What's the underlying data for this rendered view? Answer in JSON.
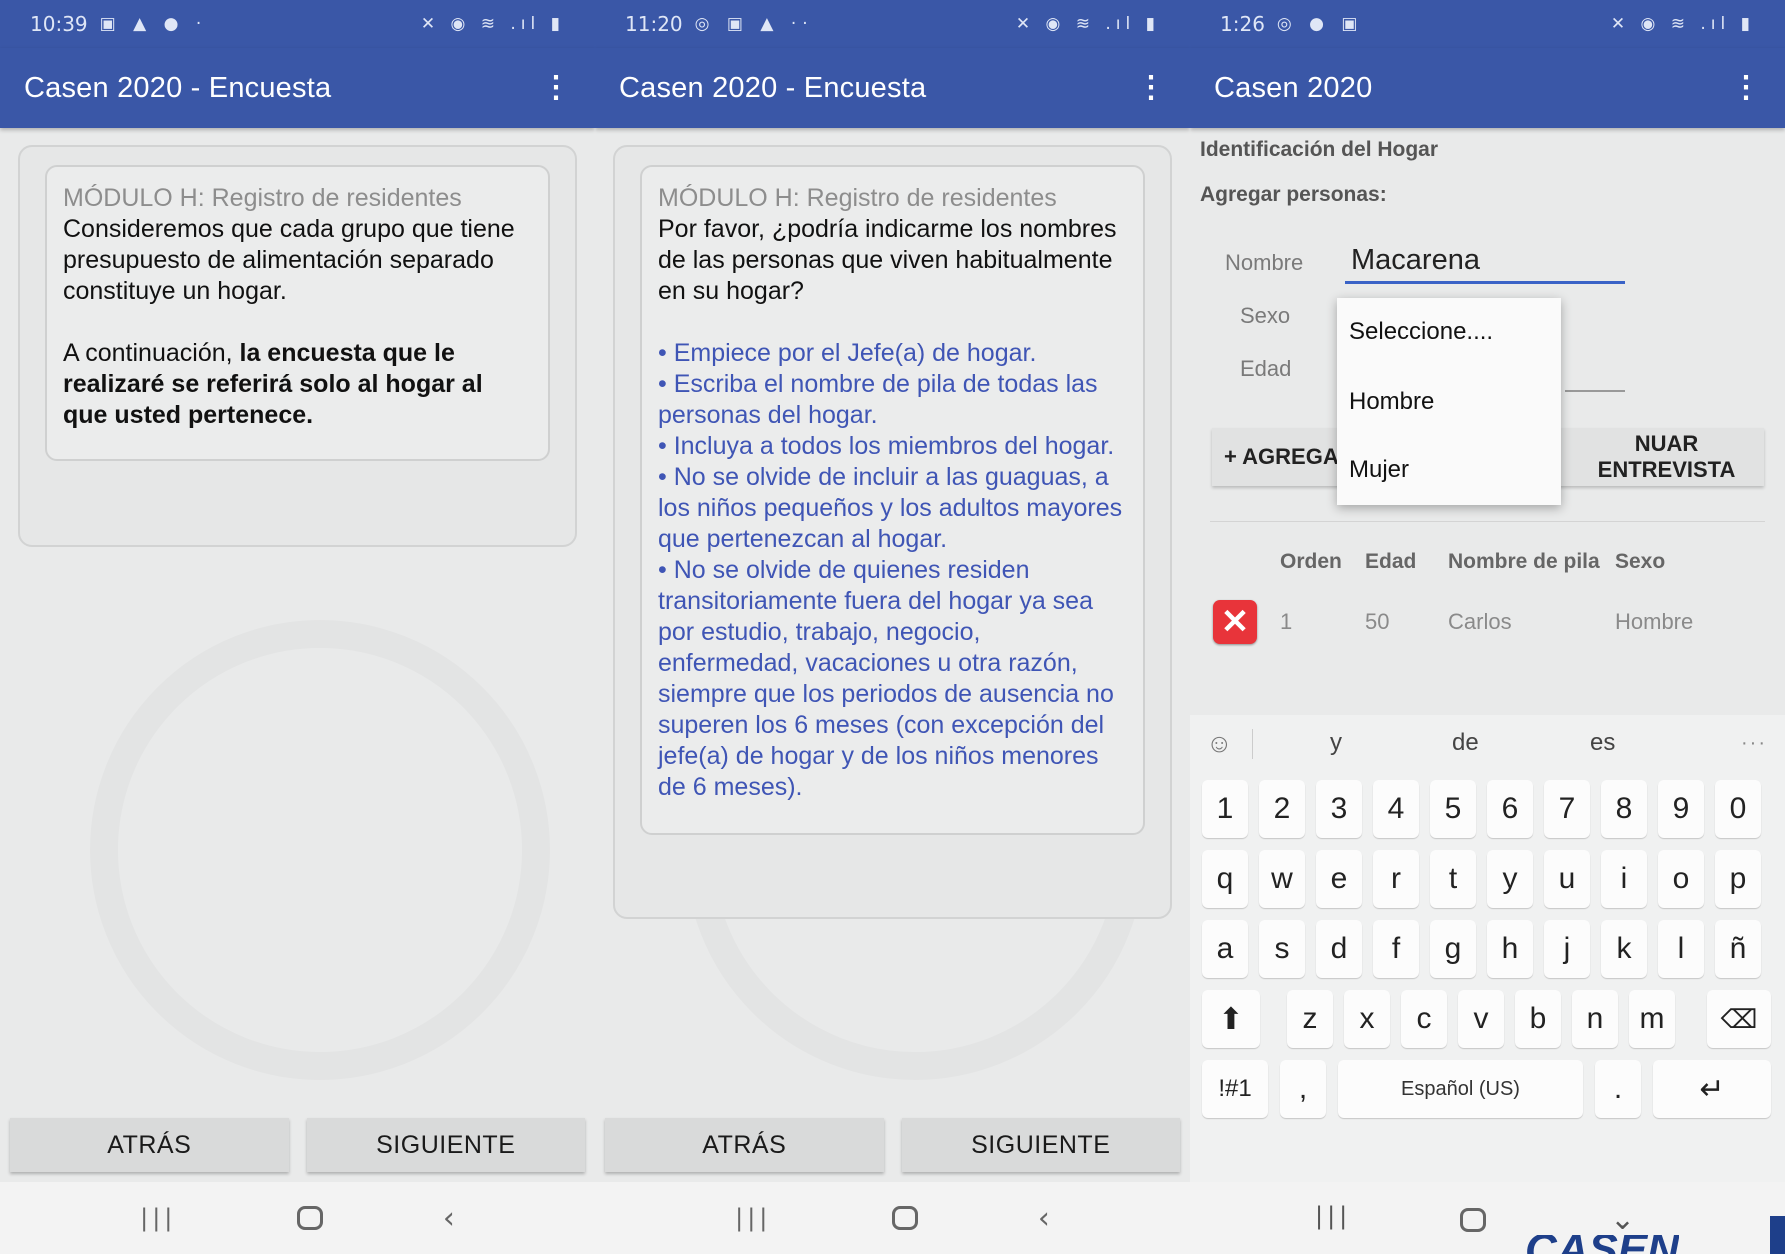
{
  "phone1": {
    "status": {
      "time": "10:39",
      "left_icons": "▣ ▲ ●  ·",
      "right_icons": "✕ ◉ ≋ .ıl ▮"
    },
    "appbar": {
      "title": "Casen 2020 - Encuesta",
      "menu": "⋮"
    },
    "card": {
      "module_title": "MÓDULO H: Registro de residentes",
      "paragraph1": "Consideremos que cada grupo que tiene presupuesto de alimentación separado constituye un hogar.",
      "paragraph2_prefix": "A continuación, ",
      "paragraph2_bold": "la encuesta que le realizaré se referirá solo al hogar al que usted pertenece."
    },
    "buttons": {
      "back": "ATRÁS",
      "next": "SIGUIENTE"
    },
    "sysnav": {
      "recent": "|||",
      "back": "‹"
    }
  },
  "phone2": {
    "status": {
      "time": "11:20",
      "left_icons": "◎ ▣ ▲  ··",
      "right_icons": "✕ ◉ ≋ .ıl ▮"
    },
    "appbar": {
      "title": "Casen 2020 - Encuesta",
      "menu": "⋮"
    },
    "card": {
      "module_title": "MÓDULO H: Registro de residentes",
      "question": "Por favor, ¿podría indicarme los nombres de las personas que viven habitualmente en su hogar?",
      "bullets": "• Empiece por el Jefe(a) de hogar.\n• Escriba el nombre de pila de todas las personas del hogar.\n• Incluya a todos los miembros del hogar.\n• No se olvide de incluir a las guaguas, a los niños pequeños y los adultos mayores que pertenezcan al hogar.\n• No se olvide de quienes residen transitoriamente fuera del hogar ya sea por estudio, trabajo, negocio, enfermedad, vacaciones u otra razón, siempre que los periodos de ausencia no superen los 6 meses (con excepción del jefe(a) de hogar y de los niños menores de 6 meses)."
    },
    "buttons": {
      "back": "ATRÁS",
      "next": "SIGUIENTE"
    },
    "sysnav": {
      "recent": "|||",
      "back": "‹"
    }
  },
  "phone3": {
    "status": {
      "time": "1:26",
      "left_icons": "◎ ● ▣",
      "right_icons": "✕ ◉ ≋ .ıl ▮"
    },
    "appbar": {
      "title": "Casen 2020",
      "menu": "⋮"
    },
    "section_title": "Identificación del Hogar",
    "add_label": "Agregar personas:",
    "form": {
      "name_label": "Nombre",
      "name_value": "Macarena",
      "sex_label": "Sexo",
      "age_label": "Edad"
    },
    "dropdown": {
      "options": [
        "Seleccione....",
        "Hombre",
        "Mujer"
      ]
    },
    "actions": {
      "add": "+ AGREGAI",
      "continue": "NUAR ENTREVISTA"
    },
    "table": {
      "headers": [
        "Orden",
        "Edad",
        "Nombre de pila",
        "Sexo"
      ],
      "rows": [
        {
          "orden": "1",
          "edad": "50",
          "nombre": "Carlos",
          "sexo": "Hombre"
        }
      ],
      "delete_glyph": "✕"
    },
    "keyboard": {
      "suggestions": [
        "y",
        "de",
        "es"
      ],
      "emoji_glyph": "☺",
      "more_glyph": "···",
      "row_numbers": [
        "1",
        "2",
        "3",
        "4",
        "5",
        "6",
        "7",
        "8",
        "9",
        "0"
      ],
      "row1": [
        "q",
        "w",
        "e",
        "r",
        "t",
        "y",
        "u",
        "i",
        "o",
        "p"
      ],
      "row2": [
        "a",
        "s",
        "d",
        "f",
        "g",
        "h",
        "j",
        "k",
        "l",
        "ñ"
      ],
      "row3": [
        "z",
        "x",
        "c",
        "v",
        "b",
        "n",
        "m"
      ],
      "shift": "⬆",
      "backspace": "⌫",
      "symbols": "!#1",
      "comma": ",",
      "space": "Español (US)",
      "period": ".",
      "enter": "↵"
    },
    "sysnav": {
      "recent": "|||",
      "hide": "⌄"
    },
    "logo": "CASEN"
  },
  "colors": {
    "appbar": "#3a57a7",
    "blue_text": "#3f55b5",
    "delete_red": "#e8343a",
    "input_underline": "#3a63c7"
  }
}
